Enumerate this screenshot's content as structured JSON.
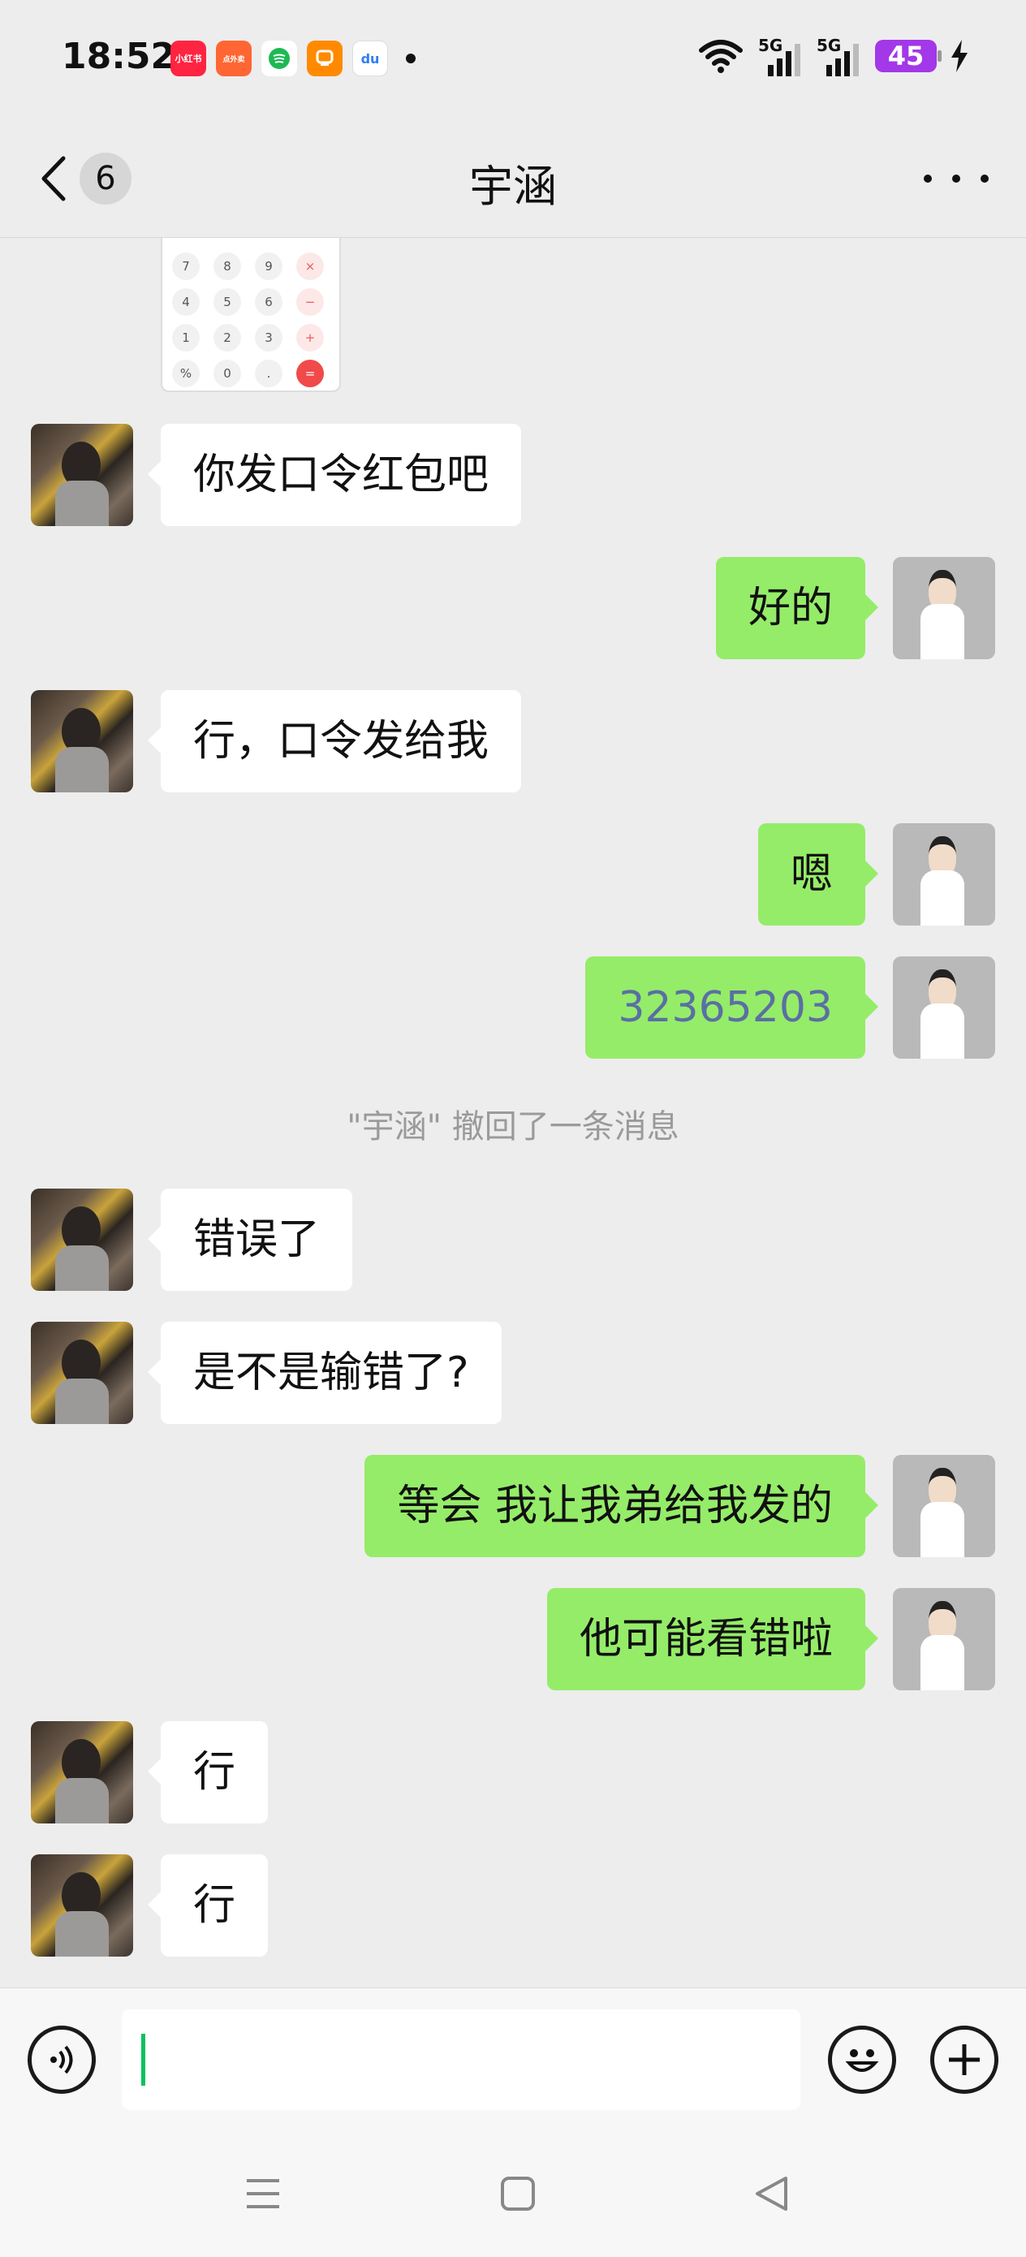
{
  "status_bar": {
    "time": "18:52",
    "apps": [
      {
        "name": "xiaohongshu-icon",
        "label": "小红书",
        "color": "#ff2442"
      },
      {
        "name": "dianping-icon",
        "label": "点外卖",
        "color": "#ff6633"
      },
      {
        "name": "chat-app-icon",
        "label": "",
        "color": "#1db954"
      },
      {
        "name": "taobao-icon",
        "label": "",
        "color": "#ff8a00"
      },
      {
        "name": "baidu-icon",
        "label": "du",
        "color": "#2d7df6"
      }
    ],
    "network_1": "5G",
    "network_2": "5G",
    "battery": "45"
  },
  "header": {
    "unread_count": "6",
    "title": "宇涵"
  },
  "calculator_keys": [
    {
      "k": "7",
      "t": ""
    },
    {
      "k": "8",
      "t": ""
    },
    {
      "k": "9",
      "t": ""
    },
    {
      "k": "×",
      "t": "op"
    },
    {
      "k": "4",
      "t": ""
    },
    {
      "k": "5",
      "t": ""
    },
    {
      "k": "6",
      "t": ""
    },
    {
      "k": "−",
      "t": "op"
    },
    {
      "k": "1",
      "t": ""
    },
    {
      "k": "2",
      "t": ""
    },
    {
      "k": "3",
      "t": ""
    },
    {
      "k": "+",
      "t": "op"
    },
    {
      "k": "%",
      "t": ""
    },
    {
      "k": "0",
      "t": ""
    },
    {
      "k": ".",
      "t": ""
    },
    {
      "k": "=",
      "t": "eq"
    }
  ],
  "messages": [
    {
      "side": "left",
      "text": "你发口令红包吧"
    },
    {
      "side": "right",
      "text": "好的"
    },
    {
      "side": "left",
      "text": "行，口令发给我"
    },
    {
      "side": "right",
      "text": "嗯"
    },
    {
      "side": "right",
      "text": "32365203"
    },
    {
      "side": "left",
      "text": "错误了"
    },
    {
      "side": "left",
      "text": "是不是输错了?"
    },
    {
      "side": "right",
      "text": "等会  我让我弟给我发的"
    },
    {
      "side": "right",
      "text": "他可能看错啦"
    },
    {
      "side": "left",
      "text": "行"
    },
    {
      "side": "left",
      "text": "行"
    }
  ],
  "system_note": "\"宇涵\" 撤回了一条消息"
}
